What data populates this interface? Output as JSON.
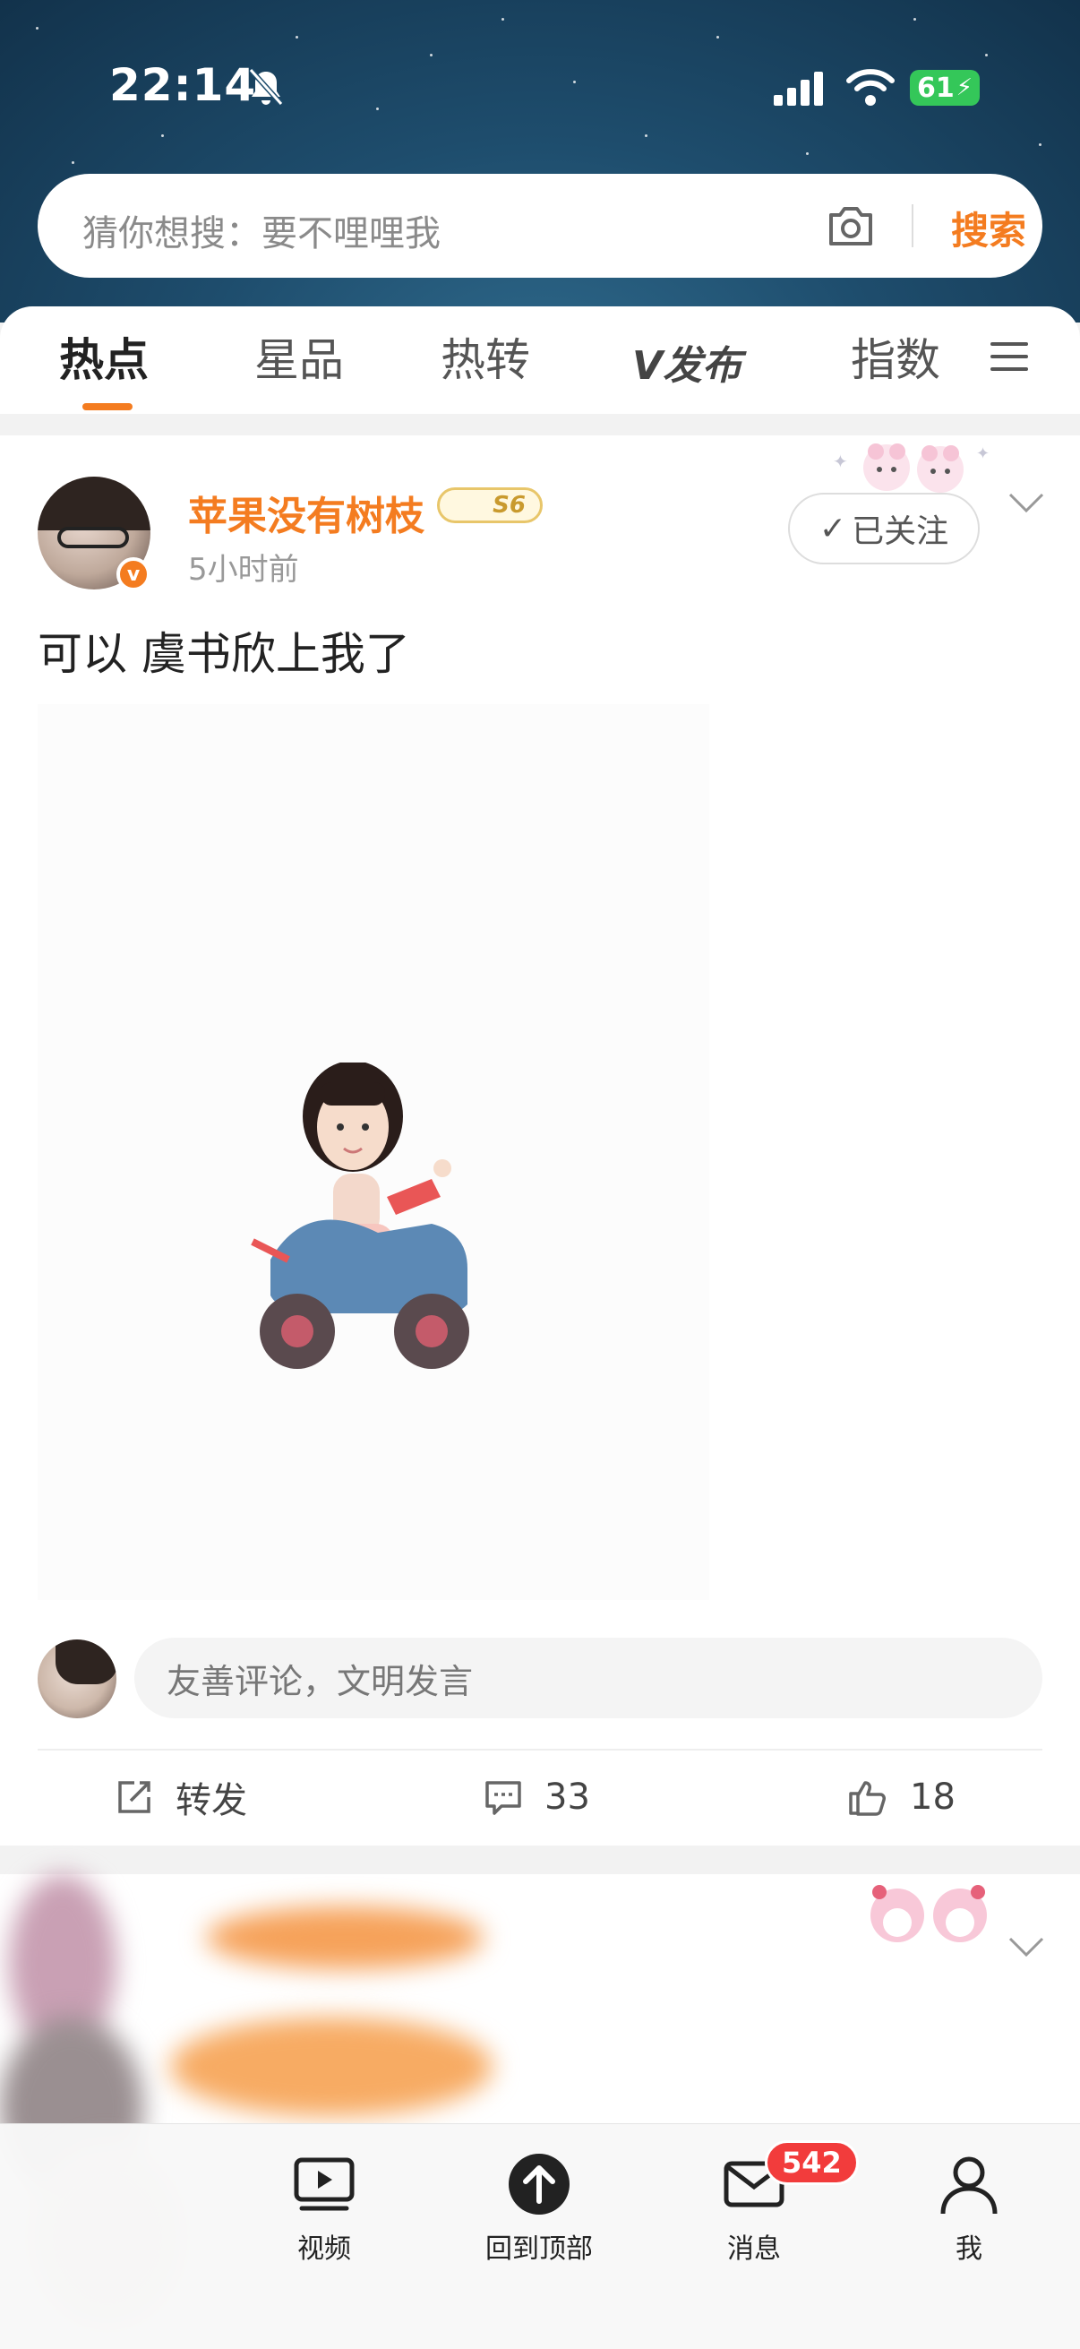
{
  "status_bar": {
    "time": "22:14",
    "battery": "61"
  },
  "search": {
    "placeholder": "猜你想搜：要不哩哩我",
    "button": "搜索"
  },
  "tabs": {
    "items": [
      "热点",
      "星品",
      "热转",
      "发布",
      "指数"
    ],
    "active": "热点"
  },
  "post": {
    "username": "苹果没有树枝",
    "level": "S6",
    "time": "5小时前",
    "follow_label": "已关注",
    "text": "可以 虞书欣上我了",
    "comment_placeholder": "友善评论，文明发言",
    "repost_label": "转发",
    "comment_count": "33",
    "like_count": "18"
  },
  "bottom_nav": {
    "video": "视频",
    "top": "回到顶部",
    "messages": "消息",
    "messages_badge": "542",
    "me": "我"
  },
  "colors": {
    "accent": "#f47c20",
    "badge": "#f23c3c"
  }
}
